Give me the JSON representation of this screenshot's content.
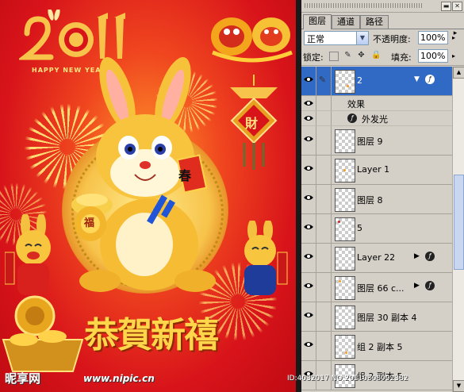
{
  "poster": {
    "year": "2011",
    "happy_new_year": "HAPPY NEW YEAR",
    "greeting": "恭賀新禧",
    "fortune_char": "財",
    "spring_char": "春",
    "blessing_char": "福",
    "watermark_brand": "昵享网",
    "watermark_url": "www.nipic.cn",
    "watermark_id": "ID:4032017 NO:20110308092382"
  },
  "panel": {
    "tabs": [
      {
        "label": "图层",
        "active": true
      },
      {
        "label": "通道",
        "active": false
      },
      {
        "label": "路径",
        "active": false
      }
    ],
    "blend_mode": "正常",
    "opacity_label": "不透明度:",
    "opacity_value": "100%",
    "lock_label": "锁定:",
    "fill_label": "填充:",
    "fill_value": "100%",
    "effects_label": "效果",
    "outer_glow_label": "外发光",
    "layers": [
      {
        "name": "2",
        "selected": true,
        "fx": true,
        "expanded": true
      },
      {
        "name": "图层 9",
        "selected": false,
        "fx": false
      },
      {
        "name": "Layer 1",
        "selected": false,
        "fx": false
      },
      {
        "name": "图层 8",
        "selected": false,
        "fx": false
      },
      {
        "name": "5",
        "selected": false,
        "fx": false
      },
      {
        "name": "Layer 22",
        "selected": false,
        "fx": true
      },
      {
        "name": "图层 66 c...",
        "selected": false,
        "fx": true
      },
      {
        "name": "图层 30 副本 4",
        "selected": false,
        "fx": false
      },
      {
        "name": "组 2 副本 5",
        "selected": false,
        "fx": false
      },
      {
        "name": "组 2 副本 5",
        "selected": false,
        "fx": false
      }
    ]
  },
  "colors": {
    "poster_red": "#d8141a",
    "gold": "#f7c34a",
    "selection_blue": "#316ac5",
    "panel_gray": "#d4d0c8"
  }
}
